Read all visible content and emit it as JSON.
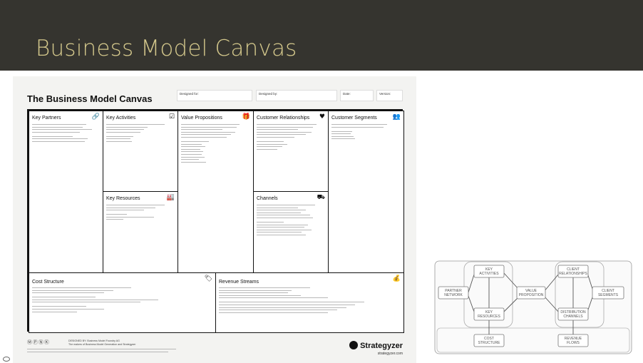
{
  "slide": {
    "title": "Business Model Canvas"
  },
  "poster": {
    "title": "The Business Model Canvas",
    "meta": {
      "designed_for": "Designed for:",
      "designed_by": "Designed by:",
      "date": "Date:",
      "version": "Version:"
    },
    "blocks": {
      "key_partners": {
        "title": "Key Partners",
        "icon": "link-icon"
      },
      "key_activities": {
        "title": "Key Activities",
        "icon": "checkbox-icon"
      },
      "value_propositions": {
        "title": "Value Propositions",
        "icon": "gift-icon"
      },
      "customer_relationships": {
        "title": "Customer Relationships",
        "icon": "heart-icon"
      },
      "customer_segments": {
        "title": "Customer Segments",
        "icon": "people-icon"
      },
      "key_resources": {
        "title": "Key Resources",
        "icon": "factory-icon"
      },
      "channels": {
        "title": "Channels",
        "icon": "truck-icon"
      },
      "cost_structure": {
        "title": "Cost Structure",
        "icon": "tag-icon"
      },
      "revenue_streams": {
        "title": "Revenue Streams",
        "icon": "moneybag-icon"
      }
    },
    "footer": {
      "designed_by_line1": "DESIGNED BY: Business Model Foundry AG",
      "designed_by_line2": "The makers of Business Model Generation and Strategyzer",
      "brand": "Strategyzer",
      "url": "strategyzer.com"
    }
  },
  "diagram": {
    "nodes": {
      "key_activities": "KEY ACTIVITIES",
      "client_relationships": "CLIENT RELATIONSHIPS",
      "partner_network": "PARTNER NETWORK",
      "value_proposition": "VALUE PROPOSITION",
      "client_segments": "CLIENT SEGMENTS",
      "key_resources": "KEY RESOURCES",
      "distribution_channels": "DISTRIBUTION CHANNELS",
      "cost_structure": "COST STRUCTURE",
      "revenue_flows": "REVENUE FLOWS"
    }
  }
}
